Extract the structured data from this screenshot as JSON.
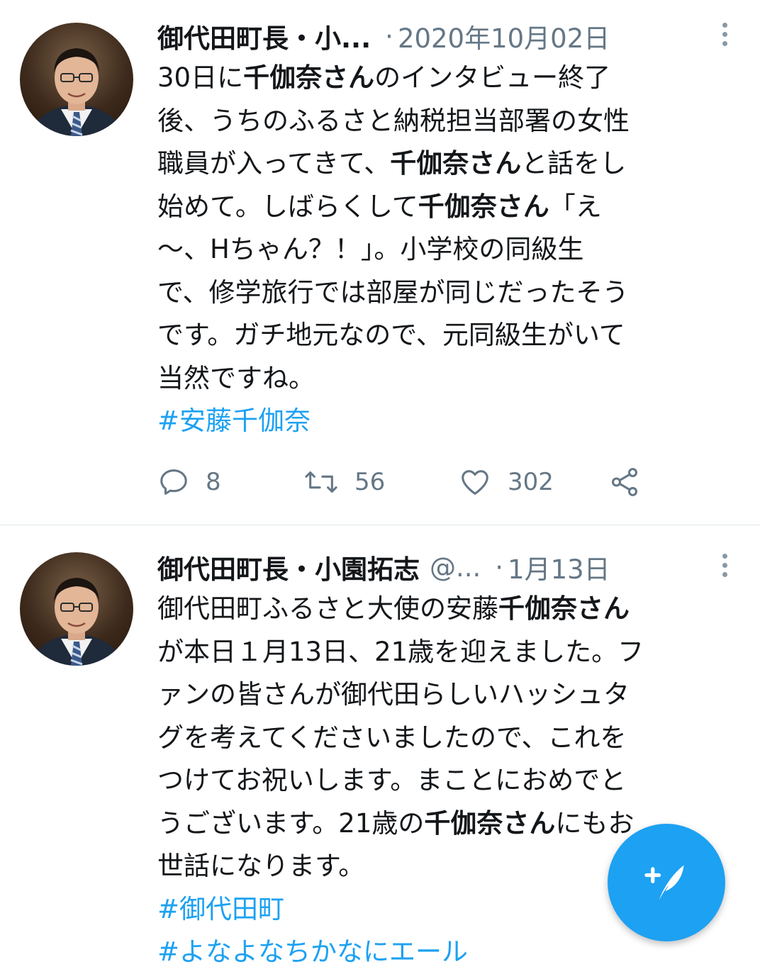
{
  "tweets": [
    {
      "author_name": "御代田町長・小...",
      "handle": "",
      "separator": "·",
      "date": "2020年10月02日",
      "lines": [
        [
          {
            "t": "30日に"
          },
          {
            "t": "千伽奈さん",
            "b": true
          },
          {
            "t": "のインタビュー終了"
          }
        ],
        [
          {
            "t": "後、うちのふるさと納税担当部署の女性"
          }
        ],
        [
          {
            "t": "職員が入ってきて、"
          },
          {
            "t": "千伽奈さん",
            "b": true
          },
          {
            "t": "と話をし"
          }
        ],
        [
          {
            "t": "始めて。しばらくして"
          },
          {
            "t": "千伽奈さん",
            "b": true
          },
          {
            "t": "「え"
          }
        ],
        [
          {
            "t": "〜、Hちゃん？！」。小学校の同級生"
          }
        ],
        [
          {
            "t": "で、修学旅行では部屋が同じだったそう"
          }
        ],
        [
          {
            "t": "です。ガチ地元なので、元同級生がいて"
          }
        ],
        [
          {
            "t": "当然ですね。"
          }
        ]
      ],
      "hashtags": [
        "#安藤千伽奈"
      ],
      "counts": {
        "replies": "8",
        "retweets": "56",
        "likes": "302"
      }
    },
    {
      "author_name": "御代田町長・小園拓志",
      "handle": "@...",
      "separator": "·",
      "date": "1月13日",
      "lines": [
        [
          {
            "t": "御代田町ふるさと大使の安藤"
          },
          {
            "t": "千伽奈さん",
            "b": true
          }
        ],
        [
          {
            "t": "が本日１月13日、21歳を迎えました。フ"
          }
        ],
        [
          {
            "t": "ァンの皆さんが御代田らしいハッシュタ"
          }
        ],
        [
          {
            "t": "グを考えてくださいましたので、これを"
          }
        ],
        [
          {
            "t": "つけてお祝いします。まことにおめでと"
          }
        ],
        [
          {
            "t": "うございます。21歳の"
          },
          {
            "t": "千伽奈さん",
            "b": true
          },
          {
            "t": "にもお"
          }
        ],
        [
          {
            "t": "世話になります。"
          }
        ]
      ],
      "hashtags": [
        "#御代田町",
        "#よなよなちかなにエール"
      ]
    }
  ],
  "icons": {
    "more": "more-vertical-icon",
    "reply": "reply-icon",
    "retweet": "retweet-icon",
    "like": "heart-icon",
    "share": "share-icon",
    "compose": "compose-tweet-icon"
  },
  "colors": {
    "link": "#1da1f2",
    "secondary_text": "#657786",
    "fab": "#1da1f2"
  }
}
